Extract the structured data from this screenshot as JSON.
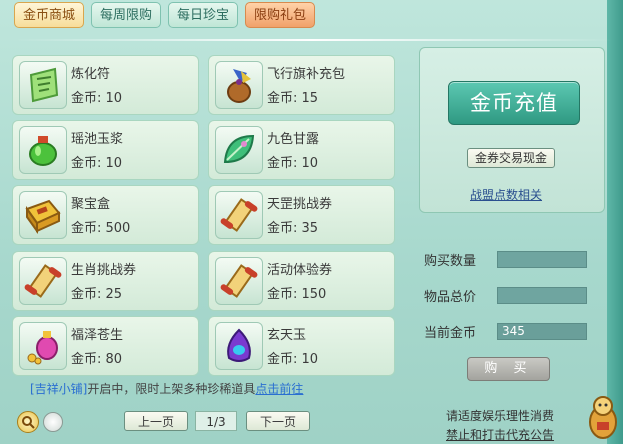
{
  "tabs": [
    {
      "label": "金币商城",
      "active": true
    },
    {
      "label": "每周限购",
      "active": false
    },
    {
      "label": "每日珍宝",
      "active": false
    },
    {
      "label": "限购礼包",
      "active": false
    }
  ],
  "items": [
    {
      "name": "炼化符",
      "price": "金币: 10",
      "icon": "green-talisman-icon"
    },
    {
      "name": "飞行旗补充包",
      "price": "金币: 15",
      "icon": "flag-bag-icon"
    },
    {
      "name": "瑶池玉浆",
      "price": "金币: 10",
      "icon": "green-jar-icon"
    },
    {
      "name": "九色甘露",
      "price": "金币: 10",
      "icon": "leaf-dew-icon"
    },
    {
      "name": "聚宝盒",
      "price": "金币: 500",
      "icon": "treasure-box-icon"
    },
    {
      "name": "天罡挑战券",
      "price": "金币: 35",
      "icon": "scroll-icon"
    },
    {
      "name": "生肖挑战券",
      "price": "金币: 25",
      "icon": "scroll-icon"
    },
    {
      "name": "活动体验券",
      "price": "金币: 150",
      "icon": "scroll-icon"
    },
    {
      "name": "福泽苍生",
      "price": "金币: 80",
      "icon": "potion-coins-icon"
    },
    {
      "name": "玄天玉",
      "price": "金币: 10",
      "icon": "purple-jade-icon"
    }
  ],
  "notice": {
    "shop": "[吉祥小铺]",
    "text": "开启中，限时上架多种珍稀道具",
    "link": "点击前往"
  },
  "pager": {
    "prev": "上一页",
    "page": "1/3",
    "next": "下一页"
  },
  "panel": {
    "recharge": "金币充值",
    "exchange": "金券交易现金",
    "alliance": "战盟点数相关"
  },
  "form": {
    "qty_label": "购买数量",
    "qty_value": "",
    "total_label": "物品总价",
    "total_value": "",
    "gold_label": "当前金币",
    "gold_value": "345",
    "buy": "购 买"
  },
  "tips": {
    "line1": "请适度娱乐理性消费",
    "line2": "禁止和打击代充公告"
  },
  "colors": {
    "accent": "#2f9982",
    "link": "#2a6fd1",
    "card": "#e3f2e3"
  }
}
